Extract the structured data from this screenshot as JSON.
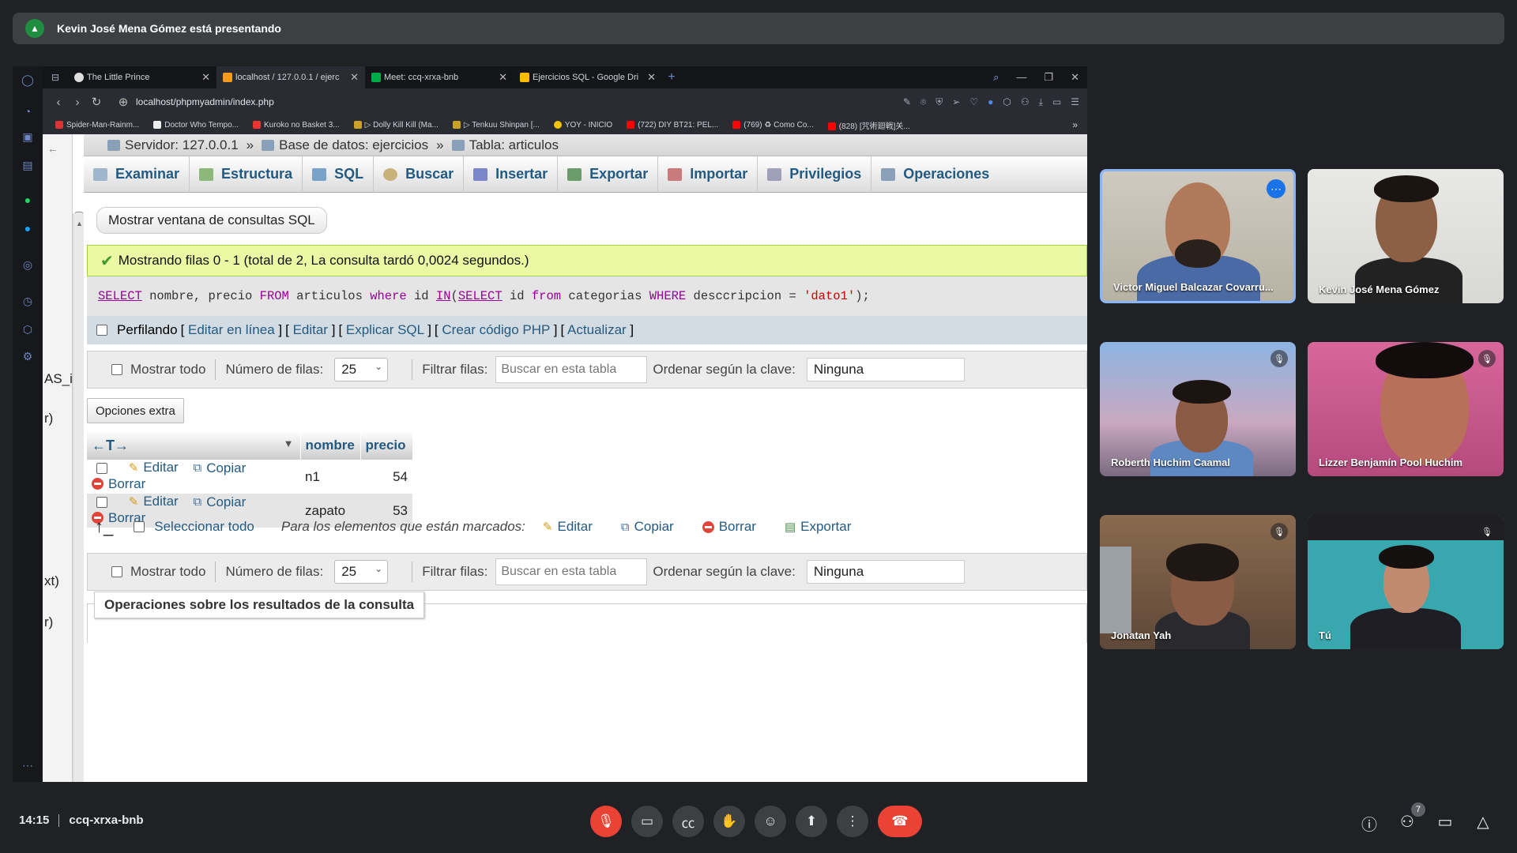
{
  "banner": {
    "text": "Kevin José Mena Gómez está presentando"
  },
  "browser": {
    "tabs": [
      {
        "title": "The Little Prince",
        "color": "#ffffff"
      },
      {
        "title": "localhost / 127.0.0.1 / ejerc",
        "color": "#f89a1c"
      },
      {
        "title": "Meet: ccq-xrxa-bnb",
        "color": "#00ac47"
      },
      {
        "title": "Ejercicios SQL - Google Dri",
        "color": "#fbbc04"
      }
    ],
    "url": "localhost/phpmyadmin/index.php",
    "bookmarks": [
      "Spider-Man-Rainm...",
      "Doctor Who Tempo...",
      "Kuroko no Basket 3...",
      "▷ Dolly Kill Kill (Ma...",
      "▷ Tenkuu Shinpan [...",
      "YOY - INICIO",
      "(722) DIY BT21: PEL...",
      "(769) ♻ Como Co...",
      "(828) [咒術廻戦]关..."
    ],
    "left_nav_fragments": [
      "AS_i",
      "r)",
      "xt)",
      "r)"
    ]
  },
  "pma": {
    "breadcrumb": {
      "server": "Servidor: 127.0.0.1",
      "database": "Base de datos: ejercicios",
      "table": "Tabla: articulos",
      "sep": "»"
    },
    "menu": [
      "Examinar",
      "Estructura",
      "SQL",
      "Buscar",
      "Insertar",
      "Exportar",
      "Importar",
      "Privilegios",
      "Operaciones"
    ],
    "show_sql_button": "Mostrar ventana de consultas SQL",
    "success_message": "Mostrando filas 0 - 1 (total de 2, La consulta tardó 0,0024 segundos.)",
    "query": {
      "select": "SELECT",
      "part1": " nombre, precio ",
      "from": "FROM",
      "part2": " articulos ",
      "where": "where",
      "part3": " id ",
      "in": "IN",
      "paren": "(",
      "select2": "SELECT",
      "part4": " id ",
      "from2": "from",
      "part5": " categorias ",
      "where2": "WHERE",
      "part6": " desccripcion = ",
      "literal": "'dato1'",
      "end": ");"
    },
    "profiling": {
      "label": "Perfilando",
      "links": [
        "Editar en línea",
        "Editar",
        "Explicar SQL",
        "Crear código PHP",
        "Actualizar"
      ]
    },
    "navigation": {
      "show_all": "Mostrar todo",
      "rows_label": "Número de filas:",
      "rows_value": "25",
      "filter_label": "Filtrar filas:",
      "filter_placeholder": "Buscar en esta tabla",
      "sort_label": "Ordenar según la clave:",
      "sort_value": "Ninguna"
    },
    "extra_options": "Opciones extra",
    "table": {
      "columns": [
        "nombre",
        "precio"
      ],
      "actions": {
        "edit": "Editar",
        "copy": "Copiar",
        "delete": "Borrar"
      },
      "rows": [
        {
          "nombre": "n1",
          "precio": "54"
        },
        {
          "nombre": "zapato",
          "precio": "53"
        }
      ]
    },
    "with_selected": {
      "select_all": "Seleccionar todo",
      "label": "Para los elementos que están marcados:",
      "edit": "Editar",
      "copy": "Copiar",
      "delete": "Borrar",
      "export": "Exportar"
    },
    "query_ops_title": "Operaciones sobre los resultados de la consulta"
  },
  "participants": [
    {
      "name": "Victor Miguel Balcazar Covarru...",
      "speaking": true,
      "muted": false
    },
    {
      "name": "Kevin José Mena Gómez",
      "speaking": false,
      "muted": false
    },
    {
      "name": "Roberth Huchim Caamal",
      "speaking": false,
      "muted": true
    },
    {
      "name": "Lizzer Benjamín Pool Huchim",
      "speaking": false,
      "muted": true
    },
    {
      "name": "Jonatan Yah",
      "speaking": false,
      "muted": true
    },
    {
      "name": "Tú",
      "speaking": false,
      "muted": true
    }
  ],
  "meeting": {
    "time": "14:15",
    "code": "ccq-xrxa-bnb",
    "participant_count": "7"
  },
  "colors": {
    "end_call": "#ea4335",
    "pma_link": "#235a81",
    "success_bg": "#ebf8a4"
  }
}
